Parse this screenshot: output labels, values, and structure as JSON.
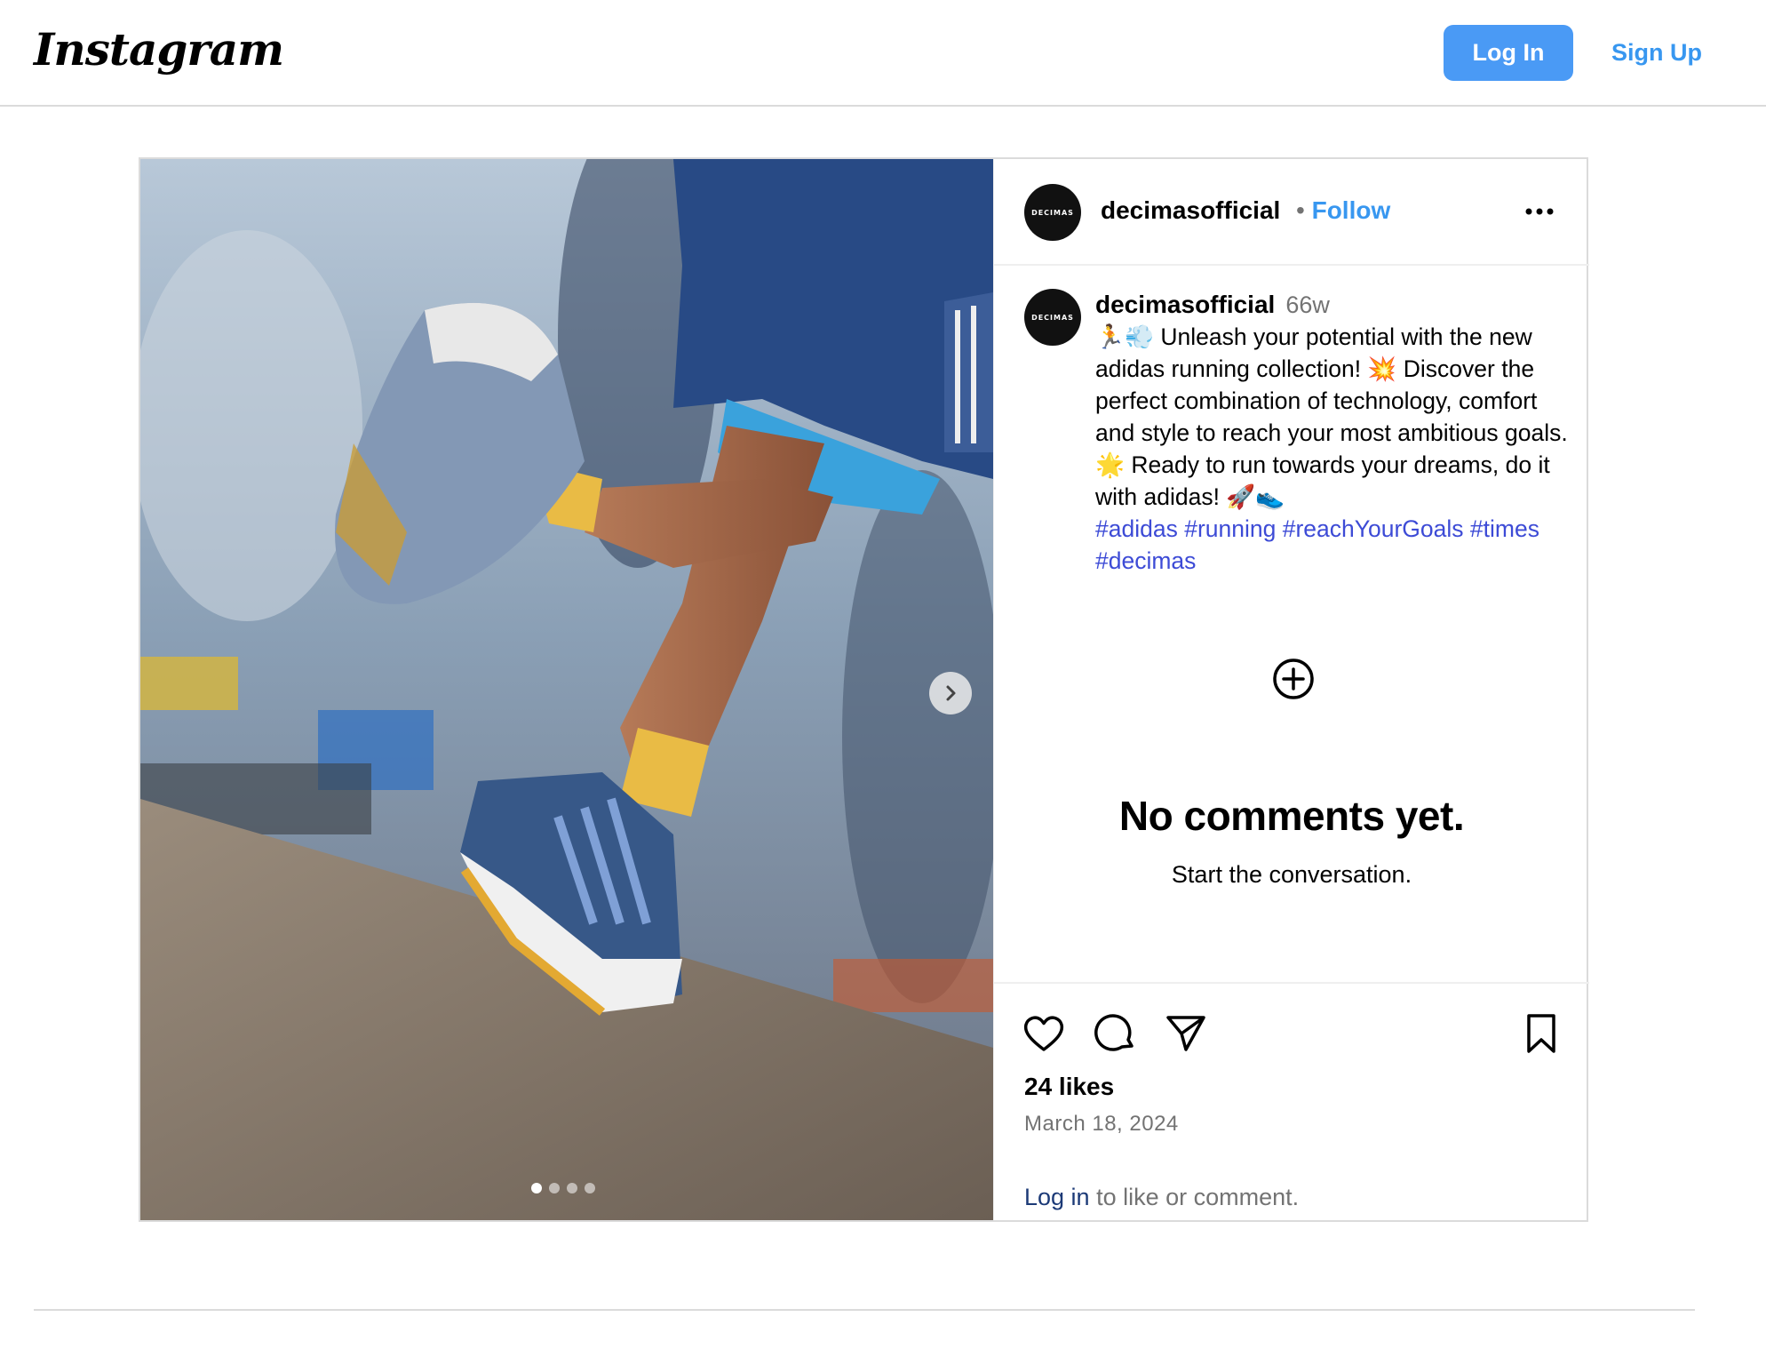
{
  "header": {
    "logo_text": "Instagram",
    "login_label": "Log In",
    "signup_label": "Sign Up",
    "accent_color": "#4a9af5"
  },
  "post": {
    "username": "decimasofficial",
    "avatar_text": "DECIMAS",
    "follow_separator": "•",
    "follow_label": "Follow",
    "more_icon": "more-horizontal-icon",
    "caption": {
      "username": "decimasofficial",
      "time_ago": "66w",
      "text": "🏃💨 Unleash your potential with the new adidas running collection! 💥 Discover the perfect combination of technology, comfort and style to reach your most ambitious goals. 🌟 Ready to run towards your dreams, do it with adidas! 🚀👟",
      "hashtags": [
        "#adidas",
        "#running",
        "#reachYourGoals",
        "#times",
        "#decimas"
      ]
    },
    "comments": {
      "empty_title": "No comments yet.",
      "empty_subtitle": "Start the conversation."
    },
    "actions": {
      "icons": [
        "heart-icon",
        "comment-icon",
        "share-icon",
        "bookmark-icon"
      ]
    },
    "likes": "24 likes",
    "date": "March 18, 2024",
    "login_prompt": {
      "link": "Log in",
      "rest": " to like or comment."
    },
    "carousel": {
      "slide_count": 4,
      "active_index": 0
    }
  }
}
